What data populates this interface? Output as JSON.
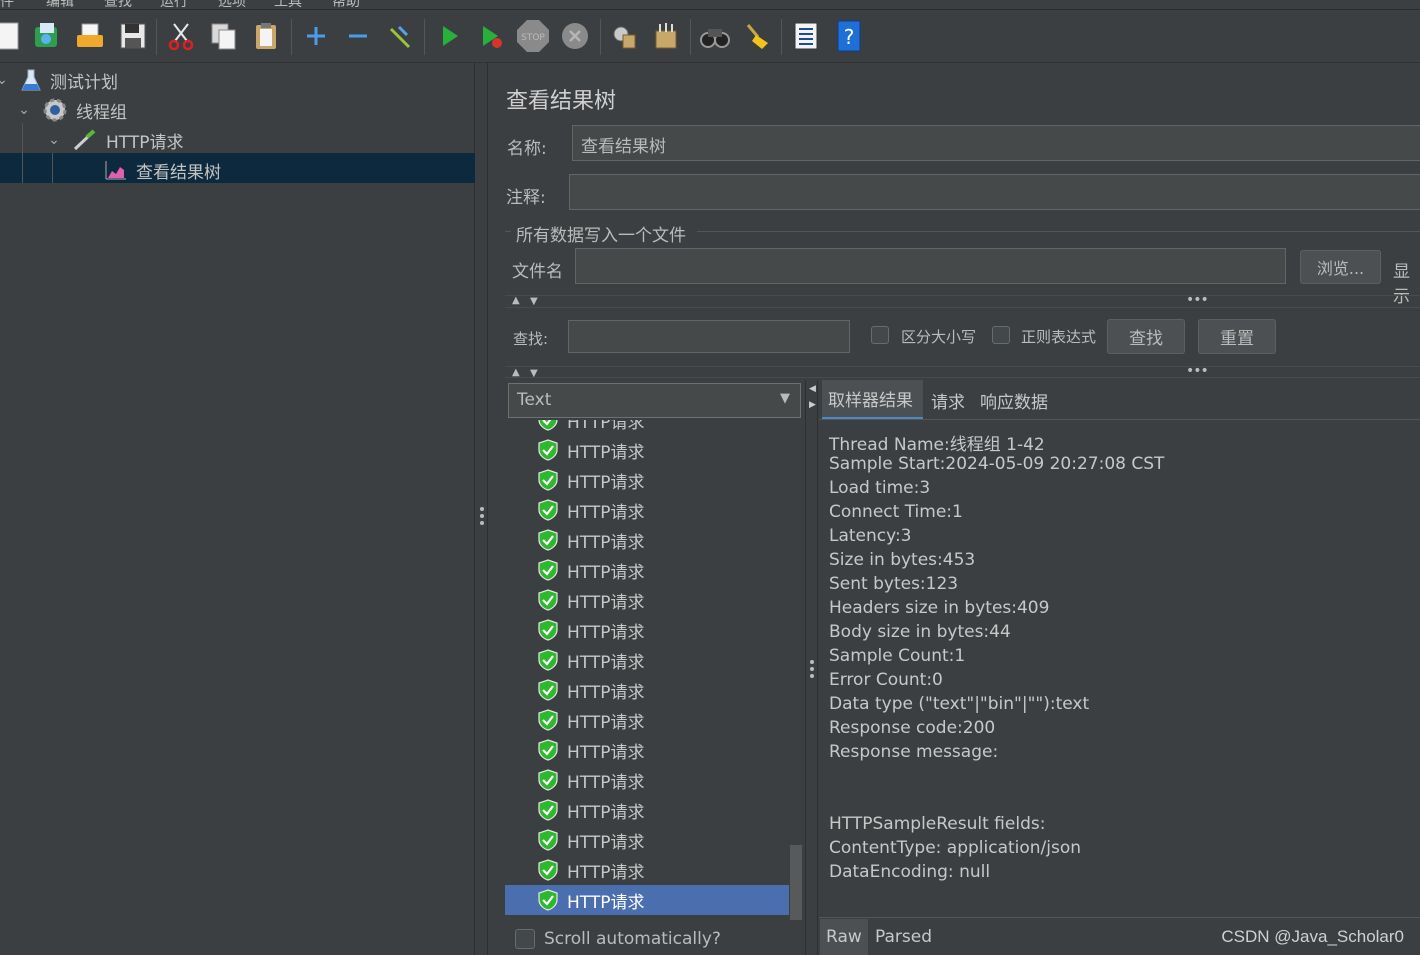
{
  "menu": [
    "文件",
    "编辑",
    "查找",
    "运行",
    "选项",
    "工具",
    "帮助"
  ],
  "toolbar": {
    "buttons": [
      "new-icon",
      "templates-icon",
      "open-icon",
      "save-icon",
      "cut-icon",
      "copy-icon",
      "paste-icon",
      "expand-icon",
      "collapse-icon",
      "toggle-icon",
      "start-icon",
      "start-no-pause-icon",
      "stop-icon",
      "shutdown-icon",
      "clear-icon",
      "clear-all-icon",
      "search-icon",
      "reset-search-icon",
      "function-helper-icon",
      "help-icon"
    ],
    "stop_label": "STOP"
  },
  "tree": {
    "nodes": [
      {
        "label": "测试计划",
        "icon": "test-plan-icon"
      },
      {
        "label": "线程组",
        "icon": "thread-group-icon"
      },
      {
        "label": "HTTP请求",
        "icon": "http-sampler-icon"
      },
      {
        "label": "查看结果树",
        "icon": "results-tree-icon"
      }
    ]
  },
  "panel": {
    "title": "查看结果树",
    "name_label": "名称:",
    "name_value": "查看结果树",
    "comment_label": "注释:",
    "comment_value": "",
    "file_section_label": "所有数据写入一个文件",
    "filename_label": "文件名",
    "filename_value": "",
    "browse_label": "浏览...",
    "display_label": "显示"
  },
  "search": {
    "label": "查找:",
    "value": "",
    "case_label": "区分大小写",
    "regex_label": "正则表达式",
    "find_button": "查找",
    "reset_button": "重置"
  },
  "renderer": {
    "selected": "Text"
  },
  "results_list": {
    "items": [
      "HTTP请求",
      "HTTP请求",
      "HTTP请求",
      "HTTP请求",
      "HTTP请求",
      "HTTP请求",
      "HTTP请求",
      "HTTP请求",
      "HTTP请求",
      "HTTP请求",
      "HTTP请求",
      "HTTP请求",
      "HTTP请求",
      "HTTP请求",
      "HTTP请求",
      "HTTP请求",
      "HTTP请求"
    ],
    "selected_index": 16,
    "scroll_auto_label": "Scroll automatically?"
  },
  "result_tabs": [
    "取样器结果",
    "请求",
    "响应数据"
  ],
  "sampler_result": {
    "lines": [
      "Thread Name:线程组 1-42",
      "Sample Start:2024-05-09 20:27:08 CST",
      "Load time:3",
      "Connect Time:1",
      "Latency:3",
      "Size in bytes:453",
      "Sent bytes:123",
      "Headers size in bytes:409",
      "Body size in bytes:44",
      "Sample Count:1",
      "Error Count:0",
      "Data type (\"text\"|\"bin\"|\"\"):text",
      "Response code:200",
      "Response message:",
      "",
      "",
      "HTTPSampleResult fields:",
      "ContentType: application/json",
      "DataEncoding: null"
    ]
  },
  "bottom_tabs": [
    "Raw",
    "Parsed"
  ],
  "watermark": "CSDN @Java_Scholar0",
  "colors": {
    "background": "#3c3f41",
    "selection": "#4b6eaf",
    "tree_selection": "#0d293e",
    "success_shield": "#2eb82e"
  }
}
